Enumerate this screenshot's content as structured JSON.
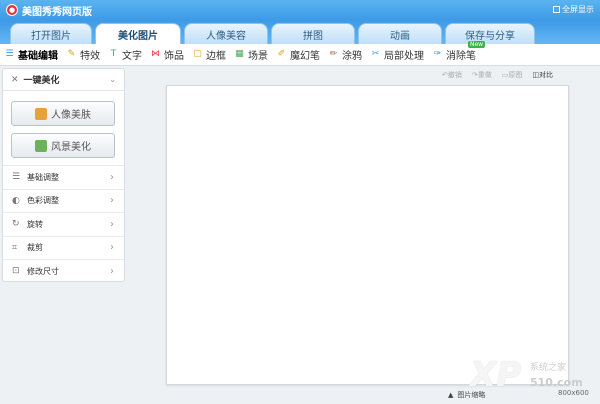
{
  "window": {
    "title": "美图秀秀网页版",
    "fullscreen_label": "全屏显示"
  },
  "tabs": [
    {
      "label": "打开图片"
    },
    {
      "label": "美化图片"
    },
    {
      "label": "人像美容"
    },
    {
      "label": "拼图"
    },
    {
      "label": "动画"
    },
    {
      "label": "保存与分享"
    }
  ],
  "tools": [
    {
      "label": "基础编辑",
      "icon": "sliders-icon"
    },
    {
      "label": "特效",
      "icon": "magic-wand-icon"
    },
    {
      "label": "文字",
      "icon": "text-icon"
    },
    {
      "label": "饰品",
      "icon": "bow-icon"
    },
    {
      "label": "边框",
      "icon": "frame-icon"
    },
    {
      "label": "场景",
      "icon": "scene-icon"
    },
    {
      "label": "魔幻笔",
      "icon": "magic-pen-icon"
    },
    {
      "label": "涂鸦",
      "icon": "brush-icon"
    },
    {
      "label": "局部处理",
      "icon": "pin-icon"
    },
    {
      "label": "消除笔",
      "icon": "eraser-icon"
    }
  ],
  "new_badge": "New",
  "left_panel": {
    "header": "一键美化",
    "portrait_button": "人像美肤",
    "landscape_button": "风景美化",
    "items": [
      {
        "label": "基础调整",
        "icon": "adjust-icon"
      },
      {
        "label": "色彩调整",
        "icon": "palette-icon"
      },
      {
        "label": "旋转",
        "icon": "rotate-icon"
      },
      {
        "label": "裁剪",
        "icon": "crop-icon"
      },
      {
        "label": "修改尺寸",
        "icon": "resize-icon"
      }
    ]
  },
  "history": {
    "undo": "撤销",
    "redo": "重做",
    "original": "原图",
    "compare": "对比"
  },
  "bottom": {
    "thumbnail_label": "图片缩略",
    "size": "800x600"
  },
  "watermark": {
    "logo": "XP",
    "site_cn": "系统之家",
    "site_num": "510.com"
  },
  "colors": {
    "title_blue": "#3d9ae6",
    "logo_red": "#e8323c",
    "badge_green": "#3cb34a"
  }
}
